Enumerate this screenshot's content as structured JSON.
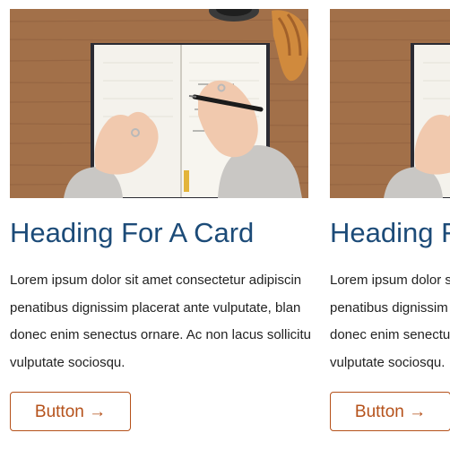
{
  "cards": [
    {
      "image_icon": "notebook-writing-photo",
      "heading": "Heading For A Card",
      "body_lines": [
        "Lorem ipsum dolor sit amet consectetur adipiscin",
        "penatibus dignissim placerat ante vulputate, blan",
        "donec enim senectus ornare. Ac non lacus sollicitu",
        "vulputate sociosqu."
      ],
      "button_label": "Button →"
    },
    {
      "image_icon": "notebook-writing-photo",
      "heading": "Heading For A Card",
      "body_lines": [
        "Lorem ipsum dolor sit amet consectetur adipiscin",
        "penatibus dignissim placerat ante vulputate, blan",
        "donec enim senectus ornare. Ac non lacus sollicitu",
        "vulputate sociosqu."
      ],
      "button_label": "Button →"
    }
  ],
  "colors": {
    "heading": "#1c4b78",
    "button_accent": "#b5511a",
    "body_text": "#222222"
  }
}
